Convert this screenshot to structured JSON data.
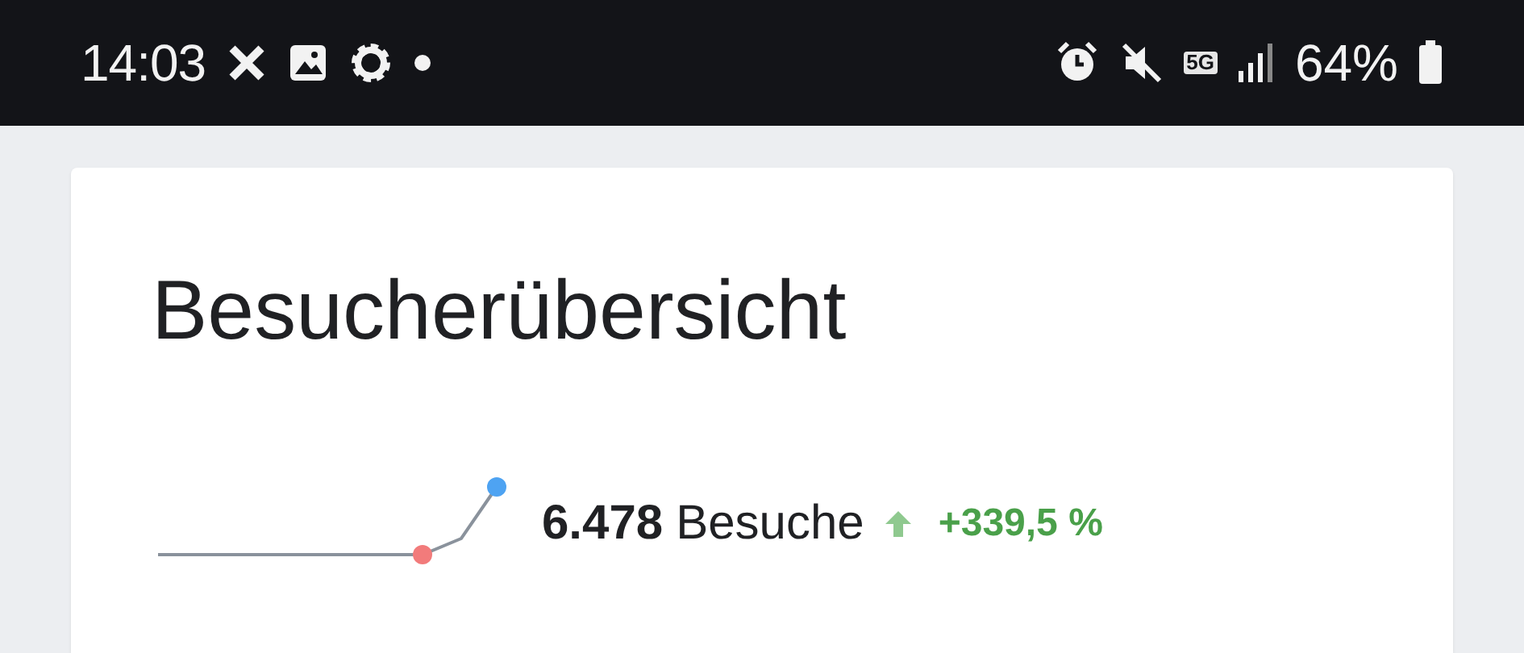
{
  "status_bar": {
    "time": "14:03",
    "battery": "64%",
    "network": "5G"
  },
  "card": {
    "title": "Besucherübersicht",
    "metric": {
      "value": "6.478",
      "label": "Besuche",
      "change": "+339,5 %",
      "rising": true
    }
  }
}
